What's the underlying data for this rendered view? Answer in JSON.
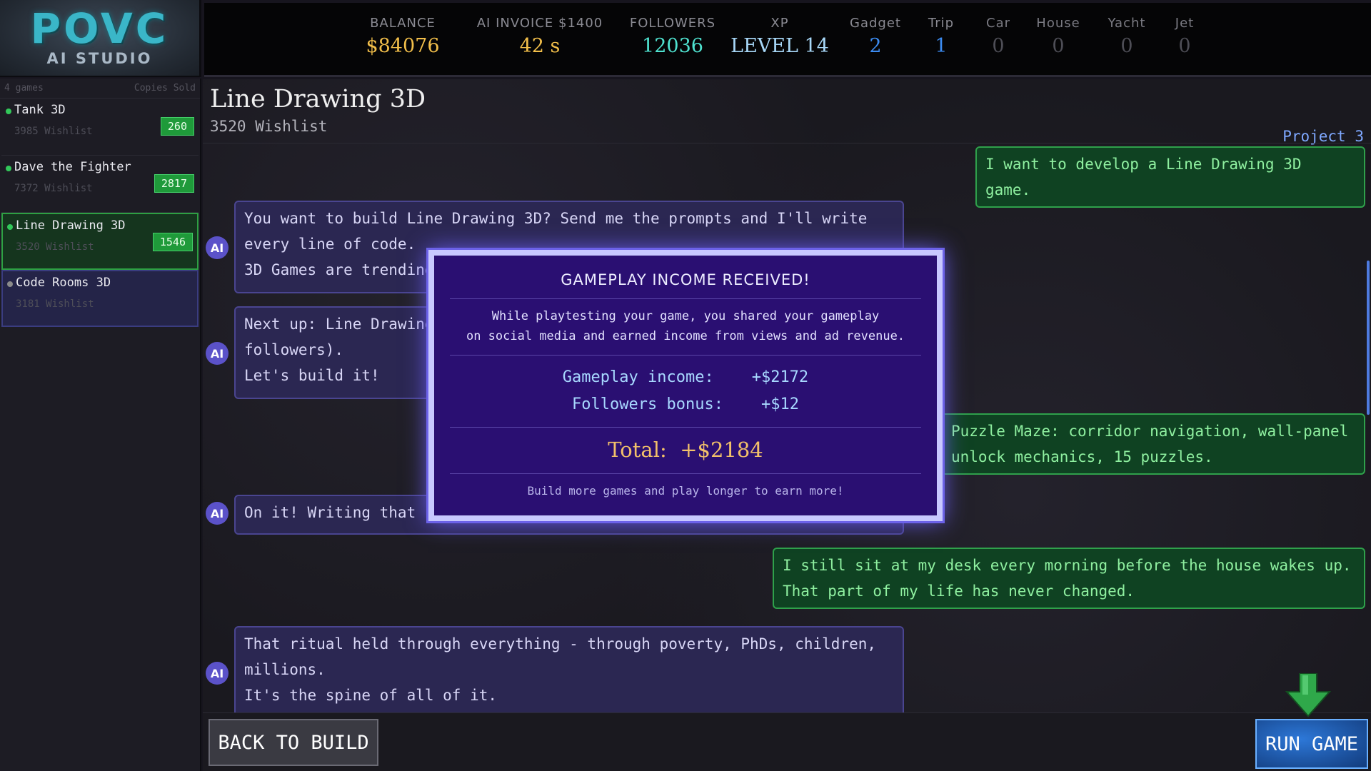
{
  "logo": {
    "main": "POVC",
    "sub": "AI STUDIO"
  },
  "stats": {
    "balance_label": "BALANCE",
    "balance_value": "$84076",
    "invoice_label": "AI INVOICE  $1400",
    "invoice_value": "42 s",
    "followers_label": "FOLLOWERS",
    "followers_value": "12036",
    "xp_label": "XP",
    "xp_value": "LEVEL 14",
    "gadget_label": "Gadget",
    "gadget_value": "2",
    "trip_label": "Trip",
    "trip_value": "1",
    "car_label": "Car",
    "car_value": "0",
    "house_label": "House",
    "house_value": "0",
    "yacht_label": "Yacht",
    "yacht_value": "0",
    "jet_label": "Jet",
    "jet_value": "0"
  },
  "sidebar": {
    "count": "4 games",
    "copies_header": "Copies Sold",
    "games": [
      {
        "title": "Tank 3D",
        "wishlist": "3985 Wishlist",
        "sold": "260"
      },
      {
        "title": "Dave the Fighter",
        "wishlist": "7372 Wishlist",
        "sold": "2817"
      },
      {
        "title": "Line Drawing 3D",
        "wishlist": "3520 Wishlist",
        "sold": "1546"
      },
      {
        "title": "Code Rooms 3D",
        "wishlist": "3181 Wishlist"
      }
    ]
  },
  "project": {
    "title": "Line Drawing 3D",
    "wishlist": "3520 Wishlist",
    "number": "Project 3"
  },
  "chat": {
    "ai_avatar": "AI",
    "m1": "I want to develop a Line Drawing 3D game.",
    "m2": "You want to build Line Drawing 3D? Send me the prompts and I'll write\nevery line of code.\n3D Games are trending",
    "m3": "Next up: Line Drawing\nfollowers).\nLet's build it!",
    "m4": "Puzzle Maze: corridor navigation, wall-panel\nunlock mechanics, 15 puzzles.",
    "m5": "On it! Writing that s",
    "m6": "I still sit at my desk every morning before the house wakes up.\nThat part of my life has never changed.",
    "m7": "That ritual held through everything - through poverty, PhDs, children,\nmillions.\nIt's the spine of all of it."
  },
  "modal": {
    "title": "GAMEPLAY INCOME RECEIVED!",
    "body": "While playtesting your game, you shared your gameplay\non social media and earned income from views and ad revenue.",
    "gameplay_label": "Gameplay income:",
    "gameplay_value": "+$2172",
    "followers_label": "Followers bonus:",
    "followers_value": "+$12",
    "total_label": "Total:",
    "total_value": "+$2184",
    "footer": "Build more games and play longer to earn more!"
  },
  "buttons": {
    "back": "BACK TO BUILD",
    "run": "RUN GAME"
  },
  "colors": {
    "user_bubble": "#0f4222",
    "ai_bubble": "#2b2752",
    "modal_bg": "#2a0f72",
    "accent_green": "#2fa14b"
  }
}
